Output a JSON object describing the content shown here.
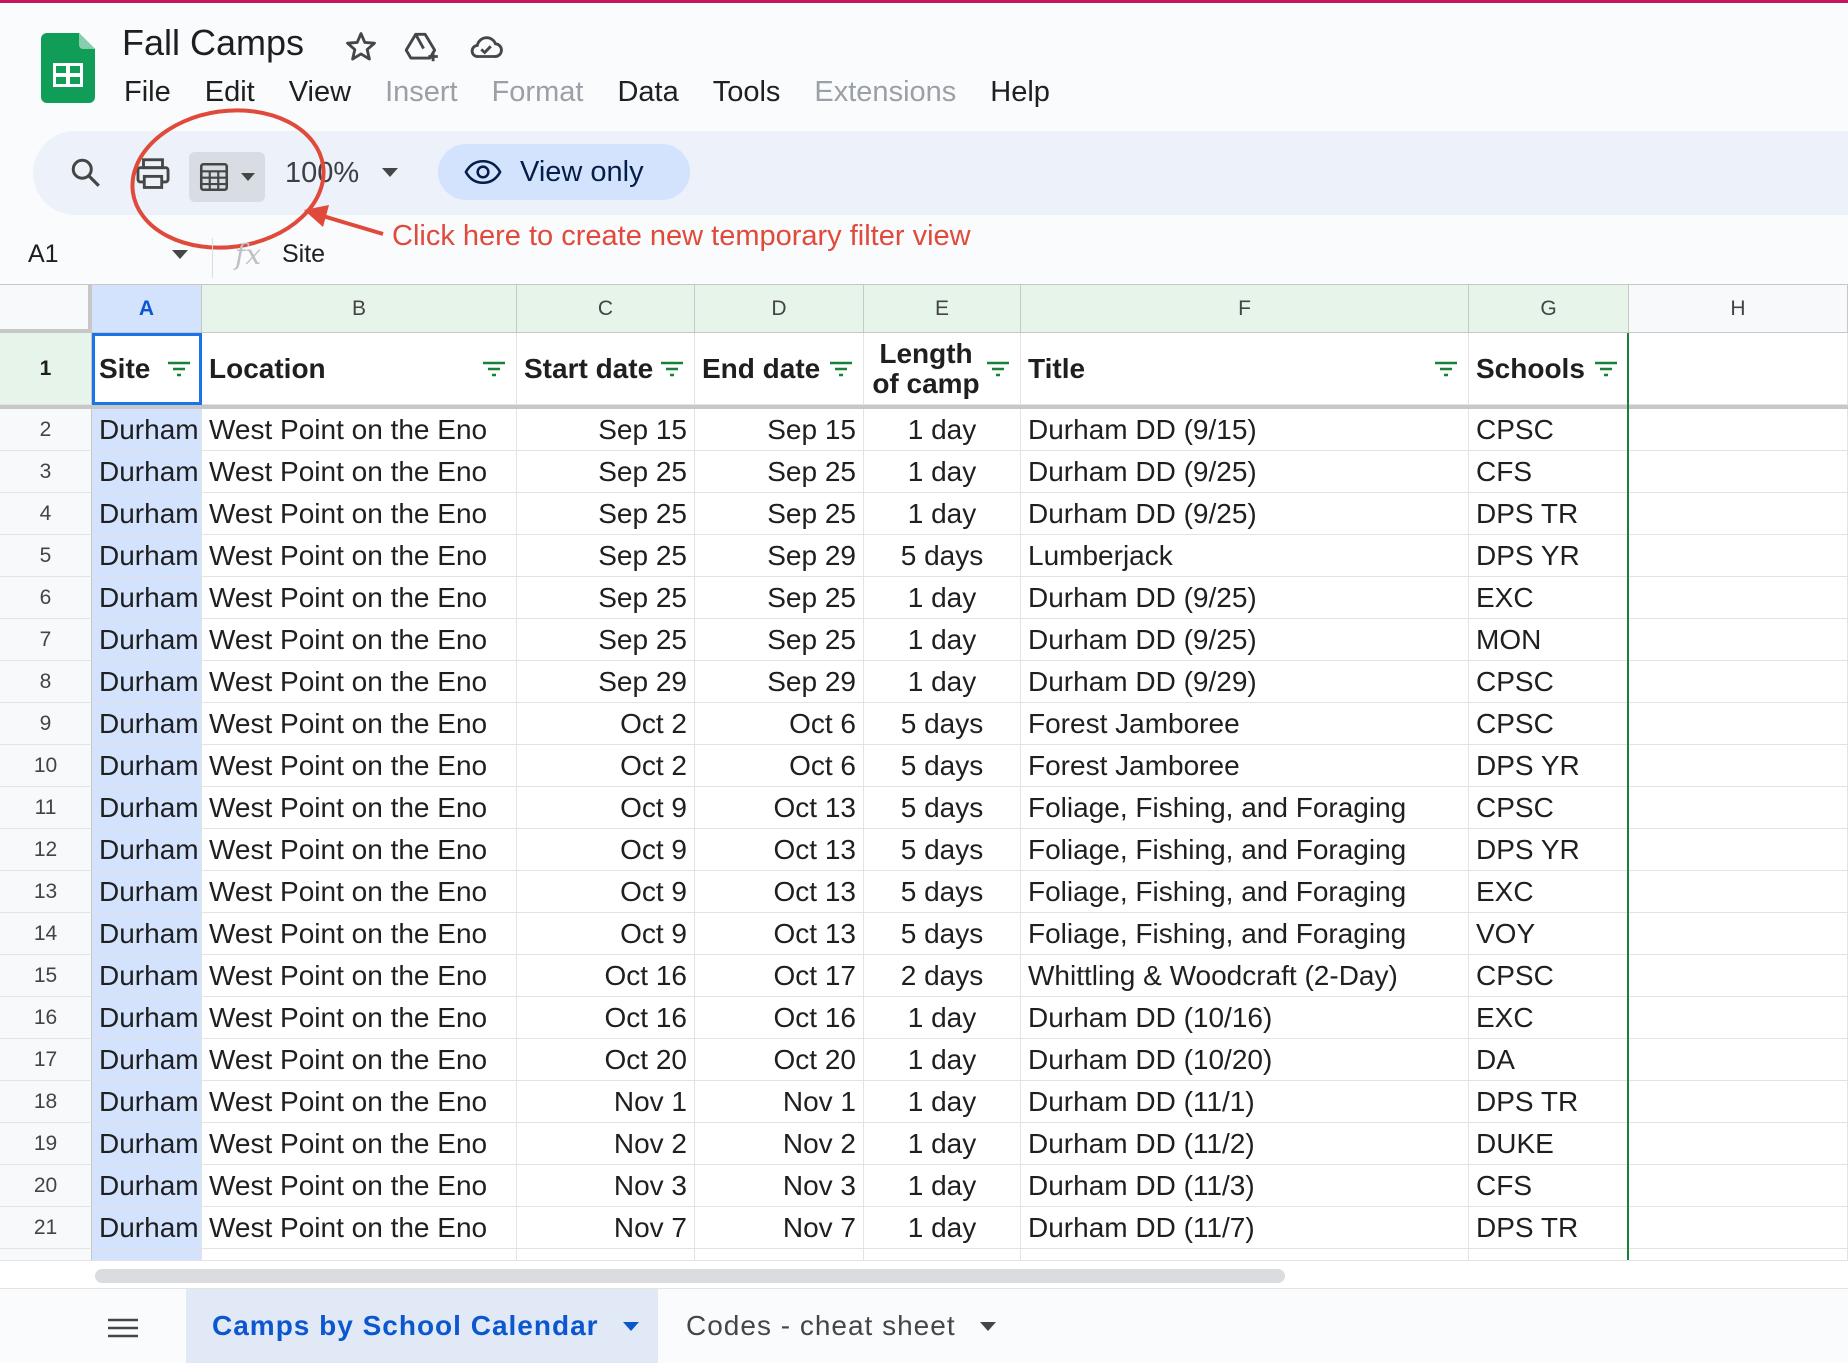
{
  "app": {
    "doc_title": "Fall Camps",
    "menus": [
      {
        "label": "File",
        "enabled": true
      },
      {
        "label": "Edit",
        "enabled": true
      },
      {
        "label": "View",
        "enabled": true
      },
      {
        "label": "Insert",
        "enabled": false
      },
      {
        "label": "Format",
        "enabled": false
      },
      {
        "label": "Data",
        "enabled": true
      },
      {
        "label": "Tools",
        "enabled": true
      },
      {
        "label": "Extensions",
        "enabled": false
      },
      {
        "label": "Help",
        "enabled": true
      }
    ]
  },
  "toolbar": {
    "zoom": "100%",
    "view_only_label": "View only"
  },
  "annotation": {
    "text": "Click here to create new temporary filter view",
    "color": "#e04a3a"
  },
  "formula_bar": {
    "name_box": "A1",
    "fx": "fx",
    "value": "Site"
  },
  "sheet": {
    "columns": [
      "A",
      "B",
      "C",
      "D",
      "E",
      "F",
      "G",
      "H"
    ],
    "header": [
      "Site",
      "Location",
      "Start date",
      "End date",
      "Length of camp",
      "Title",
      "Schools"
    ],
    "header_row_number": "1",
    "rows": [
      {
        "n": "2",
        "cells": [
          "Durham",
          "West Point on the Eno",
          "Sep 15",
          "Sep 15",
          "1 day",
          "Durham DD (9/15)",
          "CPSC"
        ]
      },
      {
        "n": "3",
        "cells": [
          "Durham",
          "West Point on the Eno",
          "Sep 25",
          "Sep 25",
          "1 day",
          "Durham DD (9/25)",
          "CFS"
        ]
      },
      {
        "n": "4",
        "cells": [
          "Durham",
          "West Point on the Eno",
          "Sep 25",
          "Sep 25",
          "1 day",
          "Durham DD (9/25)",
          "DPS TR"
        ]
      },
      {
        "n": "5",
        "cells": [
          "Durham",
          "West Point on the Eno",
          "Sep 25",
          "Sep 29",
          "5 days",
          "Lumberjack",
          "DPS YR"
        ]
      },
      {
        "n": "6",
        "cells": [
          "Durham",
          "West Point on the Eno",
          "Sep 25",
          "Sep 25",
          "1 day",
          "Durham DD (9/25)",
          "EXC"
        ]
      },
      {
        "n": "7",
        "cells": [
          "Durham",
          "West Point on the Eno",
          "Sep 25",
          "Sep 25",
          "1 day",
          "Durham DD (9/25)",
          "MON"
        ]
      },
      {
        "n": "8",
        "cells": [
          "Durham",
          "West Point on the Eno",
          "Sep 29",
          "Sep 29",
          "1 day",
          "Durham DD (9/29)",
          "CPSC"
        ]
      },
      {
        "n": "9",
        "cells": [
          "Durham",
          "West Point on the Eno",
          "Oct 2",
          "Oct 6",
          "5 days",
          "Forest Jamboree",
          "CPSC"
        ]
      },
      {
        "n": "10",
        "cells": [
          "Durham",
          "West Point on the Eno",
          "Oct 2",
          "Oct 6",
          "5 days",
          "Forest Jamboree",
          "DPS YR"
        ]
      },
      {
        "n": "11",
        "cells": [
          "Durham",
          "West Point on the Eno",
          "Oct 9",
          "Oct 13",
          "5 days",
          "Foliage, Fishing, and Foraging",
          "CPSC"
        ]
      },
      {
        "n": "12",
        "cells": [
          "Durham",
          "West Point on the Eno",
          "Oct 9",
          "Oct 13",
          "5 days",
          "Foliage, Fishing, and Foraging",
          "DPS YR"
        ]
      },
      {
        "n": "13",
        "cells": [
          "Durham",
          "West Point on the Eno",
          "Oct 9",
          "Oct 13",
          "5 days",
          "Foliage, Fishing, and Foraging",
          "EXC"
        ]
      },
      {
        "n": "14",
        "cells": [
          "Durham",
          "West Point on the Eno",
          "Oct 9",
          "Oct 13",
          "5 days",
          "Foliage, Fishing, and Foraging",
          "VOY"
        ]
      },
      {
        "n": "15",
        "cells": [
          "Durham",
          "West Point on the Eno",
          "Oct 16",
          "Oct 17",
          "2 days",
          "Whittling & Woodcraft (2-Day)",
          "CPSC"
        ]
      },
      {
        "n": "16",
        "cells": [
          "Durham",
          "West Point on the Eno",
          "Oct 16",
          "Oct 16",
          "1 day",
          "Durham DD (10/16)",
          "EXC"
        ]
      },
      {
        "n": "17",
        "cells": [
          "Durham",
          "West Point on the Eno",
          "Oct 20",
          "Oct 20",
          "1 day",
          "Durham DD (10/20)",
          "DA"
        ]
      },
      {
        "n": "18",
        "cells": [
          "Durham",
          "West Point on the Eno",
          "Nov 1",
          "Nov 1",
          "1 day",
          "Durham DD (11/1)",
          "DPS TR"
        ]
      },
      {
        "n": "19",
        "cells": [
          "Durham",
          "West Point on the Eno",
          "Nov 2",
          "Nov 2",
          "1 day",
          "Durham DD (11/2)",
          "DUKE"
        ]
      },
      {
        "n": "20",
        "cells": [
          "Durham",
          "West Point on the Eno",
          "Nov 3",
          "Nov 3",
          "1 day",
          "Durham DD (11/3)",
          "CFS"
        ]
      },
      {
        "n": "21",
        "cells": [
          "Durham",
          "West Point on the Eno",
          "Nov 7",
          "Nov 7",
          "1 day",
          "Durham DD (11/7)",
          "DPS TR"
        ]
      }
    ]
  },
  "tabs": [
    {
      "label": "Camps by School Calendar",
      "active": true
    },
    {
      "label": "Codes - cheat sheet",
      "active": false
    }
  ],
  "colors": {
    "selection": "#d3e3fd",
    "frozen_header": "#e6f4ea",
    "filter_green": "#188038",
    "brand_green": "#0f9d58"
  }
}
